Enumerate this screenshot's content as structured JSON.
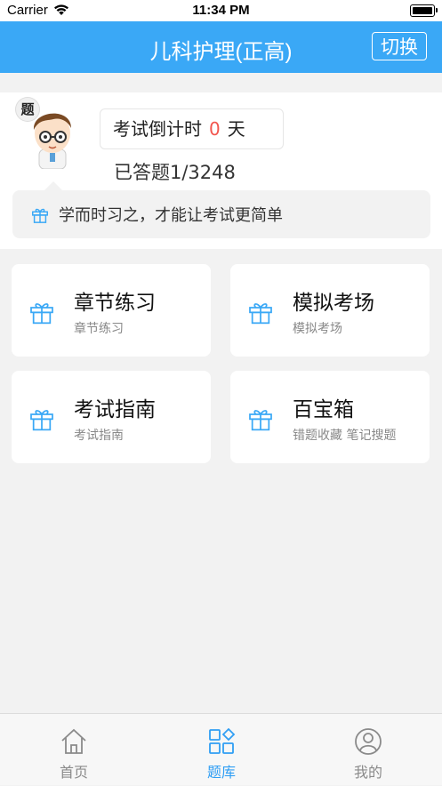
{
  "status_bar": {
    "carrier": "Carrier",
    "time": "11:34 PM"
  },
  "nav": {
    "title": "儿科护理(正高)",
    "switch_label": "切换"
  },
  "profile": {
    "avatar_tag": "题",
    "countdown_prefix": "考试倒计时",
    "countdown_days": "0",
    "countdown_unit": "天",
    "answered": "已答题1/3248",
    "motto": "学而时习之，才能让考试更简单"
  },
  "modules": [
    {
      "title": "章节练习",
      "subtitle": "章节练习"
    },
    {
      "title": "模拟考场",
      "subtitle": "模拟考场"
    },
    {
      "title": "考试指南",
      "subtitle": "考试指南"
    },
    {
      "title": "百宝箱",
      "subtitle": "错题收藏 笔记搜题"
    }
  ],
  "tabs": [
    {
      "label": "首页",
      "icon": "home-icon"
    },
    {
      "label": "题库",
      "icon": "question-bank-icon",
      "active": true
    },
    {
      "label": "我的",
      "icon": "profile-icon"
    }
  ],
  "colors": {
    "accent": "#3aa8f6",
    "countdown": "#f2564e",
    "tab_active": "#2f9ef4",
    "tab_inactive": "#8a8a8a"
  }
}
